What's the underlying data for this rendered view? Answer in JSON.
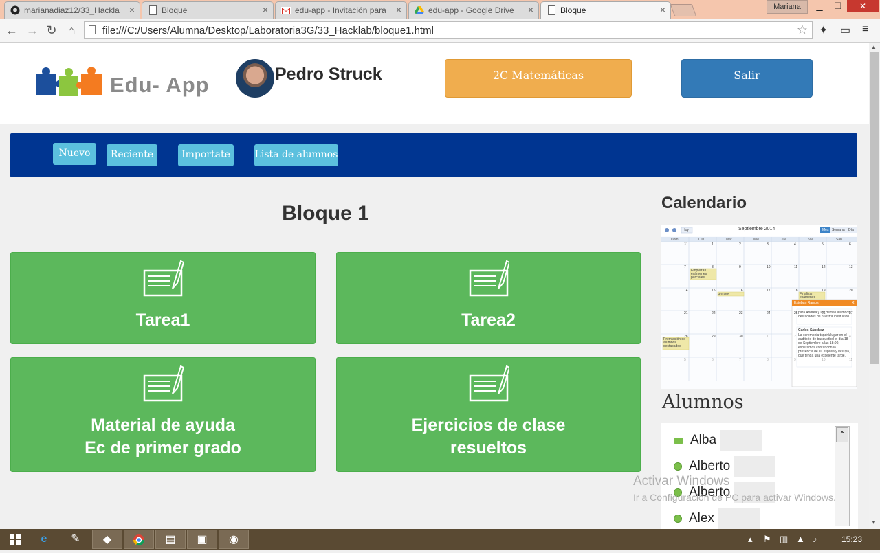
{
  "browser": {
    "tabs": [
      {
        "title": "marianadiaz12/33_Hackla",
        "icon": "github-icon"
      },
      {
        "title": "Bloque",
        "icon": "page-icon"
      },
      {
        "title": "edu-app - Invitación para",
        "icon": "gmail-icon"
      },
      {
        "title": "edu-app - Google Drive",
        "icon": "drive-icon"
      },
      {
        "title": "Bloque",
        "icon": "page-icon"
      }
    ],
    "profile": "Mariana",
    "url": "file:///C:/Users/Alumna/Desktop/Laboratoria3G/33_Hacklab/bloque1.html"
  },
  "header": {
    "logo_text": "Edu- App",
    "user_name": "Pedro Struck",
    "course_button": "2C Matemáticas",
    "logout_button": "Salir"
  },
  "nav": {
    "items": [
      "Nuevo",
      "Reciente",
      "Importate",
      "Lista de alumnos"
    ]
  },
  "main": {
    "title": "Bloque 1",
    "cards": [
      {
        "line1": "Tarea1",
        "line2": ""
      },
      {
        "line1": "Tarea2",
        "line2": ""
      },
      {
        "line1": "Material de ayuda",
        "line2": "Ec de primer grado"
      },
      {
        "line1": "Ejercicios de clase",
        "line2": "resueltos"
      }
    ]
  },
  "sidebar": {
    "calendar_title": "Calendario",
    "calendar": {
      "month": "Septiembre 2014",
      "today_btn": "Hoy",
      "views": [
        "Mes",
        "Semana",
        "Día"
      ],
      "weekdays": [
        "Dom",
        "Lun",
        "Mar",
        "Mié",
        "Jue",
        "Vie",
        "Sáb"
      ],
      "weeks": [
        [
          "31",
          "1",
          "2",
          "3",
          "4",
          "5",
          "6"
        ],
        [
          "7",
          "8",
          "9",
          "10",
          "11",
          "12",
          "13"
        ],
        [
          "14",
          "15",
          "16",
          "17",
          "18",
          "19",
          "20"
        ],
        [
          "21",
          "22",
          "23",
          "24",
          "25",
          "26",
          "27"
        ],
        [
          "28",
          "29",
          "30",
          "1",
          "2",
          "3",
          "4"
        ],
        [
          "5",
          "6",
          "7",
          "8",
          "9",
          "10",
          "11"
        ]
      ],
      "events": [
        "Empiezan exámenes parciales",
        "Asueto",
        "Finalizan exámenes",
        "Premiación de alumnos destacados"
      ],
      "popup_title": "Esteban Ramos",
      "popup_text1": "para Andrea y los demás alumnos destacados de nuestra institución.",
      "popup_author": "Carlos Sánchez",
      "popup_text2": "La ceremonia tendrá lugar en el auditorio de basquetbol el día 18 de Septiembre a las 18:00, esperamos contar con la presencia de su esposa y la suya, que tenga una excelente tarde."
    },
    "students_title": "Alumnos",
    "students": [
      "Alba",
      "Alberto",
      "Alberto",
      "Alex"
    ]
  },
  "overlay": {
    "watermark_title": "Activar Windows",
    "watermark_sub": "Ir a Configuración de PC para activar Windows."
  },
  "taskbar": {
    "clock": "15:23"
  }
}
